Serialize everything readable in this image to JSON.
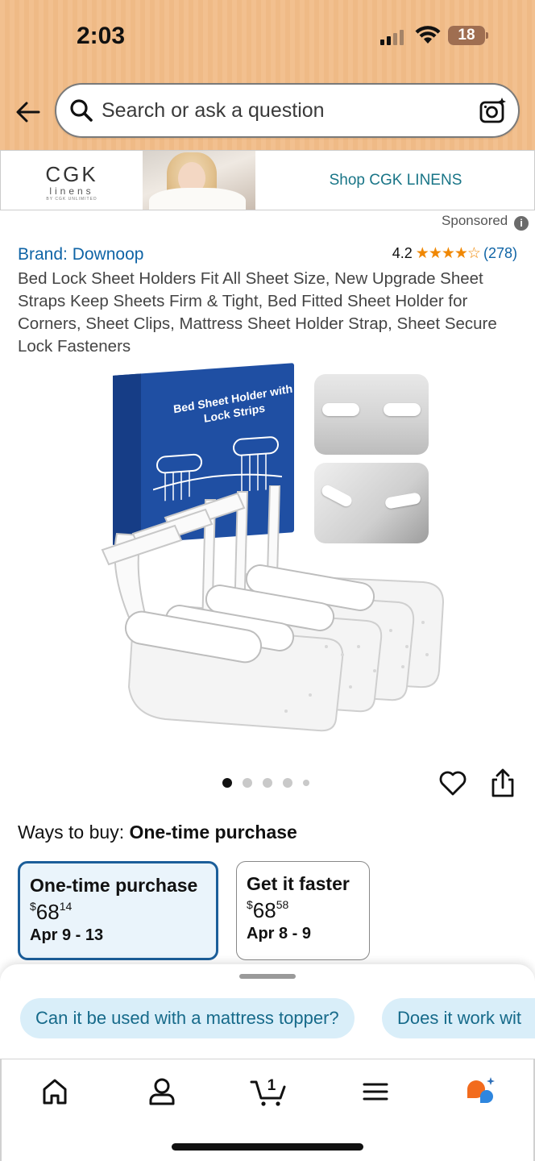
{
  "status_bar": {
    "time": "2:03",
    "battery": "18"
  },
  "search": {
    "placeholder": "Search or ask a question"
  },
  "banner": {
    "brand_name": "CGK",
    "brand_sub": "linens",
    "brand_tag": "BY CGK UNLIMITED",
    "link_label": "Shop CGK LINENS"
  },
  "sponsored_label": "Sponsored",
  "product": {
    "brand": "Brand: Downoop",
    "rating_value": "4.2",
    "rating_stars": "★★★★☆",
    "rating_count": "(278)",
    "title": "Bed Lock Sheet Holders Fit All Sheet Size, New Upgrade Sheet Straps Keep Sheets Firm & Tight, Bed Fitted Sheet Holder for Corners, Sheet Clips, Mattress Sheet Holder Strap, Sheet Secure Lock Fasteners",
    "box_label": "Bed Sheet Holder with Lock Strips",
    "image_dots": 5,
    "active_dot": 0
  },
  "buying": {
    "ways_label": "Ways to buy:",
    "ways_value": "One-time purchase",
    "options": [
      {
        "name": "One-time purchase",
        "currency": "$",
        "price_whole": "68",
        "price_fraction": "14",
        "dates": "Apr 9 - 13",
        "selected": true
      },
      {
        "name": "Get it faster",
        "currency": "$",
        "price_whole": "68",
        "price_fraction": "58",
        "dates": "Apr 8 - 9",
        "selected": false
      }
    ]
  },
  "questions": [
    "Can it be used with a mattress topper?",
    "Does it work wit"
  ],
  "nav": {
    "cart_count": "1",
    "items": [
      "home-icon",
      "account-icon",
      "cart-icon",
      "menu-icon",
      "rufus-icon"
    ]
  },
  "colors": {
    "header": "#f2c08f",
    "link": "#0f64a6",
    "star": "#f08804",
    "selected_border": "#1b5e9a",
    "chip_bg": "#d9eef9"
  }
}
